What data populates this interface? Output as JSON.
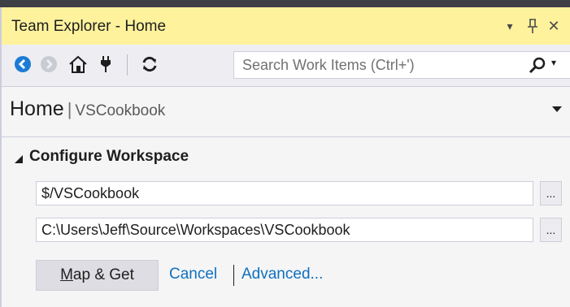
{
  "window": {
    "title": "Team Explorer - Home",
    "dropdown_glyph": "▾",
    "pin_glyph": "⊥",
    "close_glyph": "✕"
  },
  "toolbar": {
    "icons": [
      "back-arrow-icon",
      "forward-arrow-icon",
      "home-icon",
      "connect-plug-icon",
      "refresh-icon"
    ],
    "search_placeholder": "Search Work Items (Ctrl+')",
    "search_dropdown_glyph": "▾"
  },
  "header": {
    "title": "Home",
    "separator": "|",
    "project": "VSCookbook"
  },
  "section": {
    "title": "Configure Workspace",
    "server_path": "$/VSCookbook",
    "local_path": "C:\\Users\\Jeff\\Source\\Workspaces\\VSCookbook",
    "browse_label": "...",
    "map_get_mnemonic": "M",
    "map_get_rest": "ap & Get",
    "cancel_label": "Cancel",
    "advanced_label": "Advanced..."
  },
  "colors": {
    "title_bar": "#FFF29D",
    "toolbar": "#EEEEF2",
    "accent_blue": "#1C7CD5",
    "link": "#0E70C0"
  }
}
